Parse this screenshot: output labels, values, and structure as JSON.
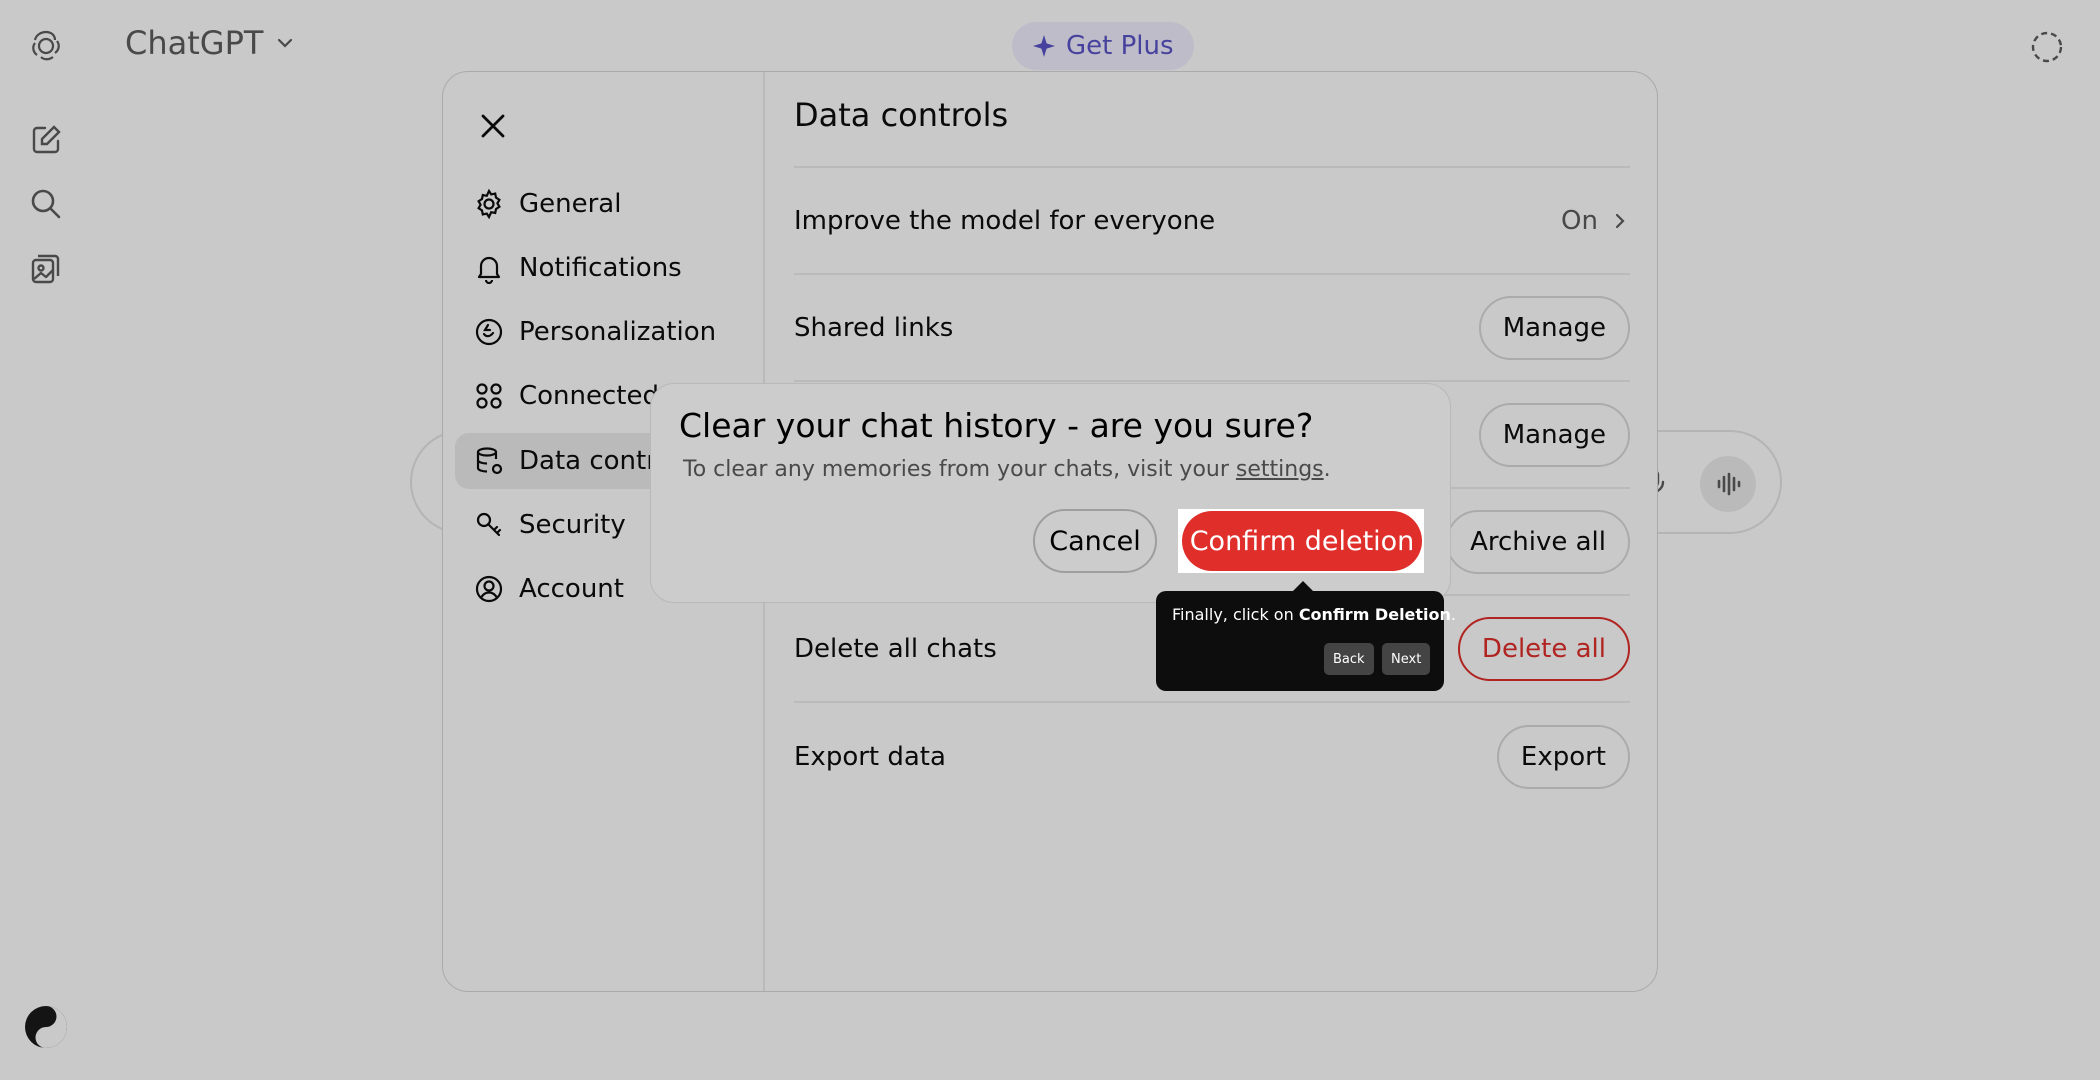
{
  "app": {
    "model_name": "ChatGPT",
    "get_plus_label": "Get Plus"
  },
  "settings": {
    "title": "Data controls",
    "nav": [
      {
        "label": "General",
        "icon": "gear-icon"
      },
      {
        "label": "Notifications",
        "icon": "bell-icon"
      },
      {
        "label": "Personalization",
        "icon": "personalization-icon"
      },
      {
        "label": "Connected apps",
        "icon": "connected-apps-icon"
      },
      {
        "label": "Data controls",
        "icon": "database-icon",
        "active": true
      },
      {
        "label": "Security",
        "icon": "key-icon"
      },
      {
        "label": "Account",
        "icon": "account-icon"
      }
    ],
    "rows": {
      "improve": {
        "label": "Improve the model for everyone",
        "value": "On"
      },
      "shared_links": {
        "label": "Shared links",
        "button": "Manage"
      },
      "archived": {
        "button": "Manage"
      },
      "archive_all": {
        "button": "Archive all"
      },
      "delete_all": {
        "label": "Delete all chats",
        "button": "Delete all"
      },
      "export": {
        "label": "Export data",
        "button": "Export"
      }
    }
  },
  "dialog": {
    "title": "Clear your chat history - are you sure?",
    "desc_prefix": "To clear any memories from your chats, visit your ",
    "desc_link": "settings",
    "desc_suffix": ".",
    "cancel_label": "Cancel",
    "confirm_label": "Confirm deletion"
  },
  "tour": {
    "text_prefix": "Finally, click on ",
    "text_bold": "Confirm Deletion",
    "text_suffix": ".",
    "back_label": "Back",
    "next_label": "Next"
  },
  "colors": {
    "danger": "#e02e2a",
    "overlay": "rgba(0,0,0,0.21)",
    "tooltip_bg": "#0d0d0d",
    "plus_accent": "#5b54c9"
  }
}
